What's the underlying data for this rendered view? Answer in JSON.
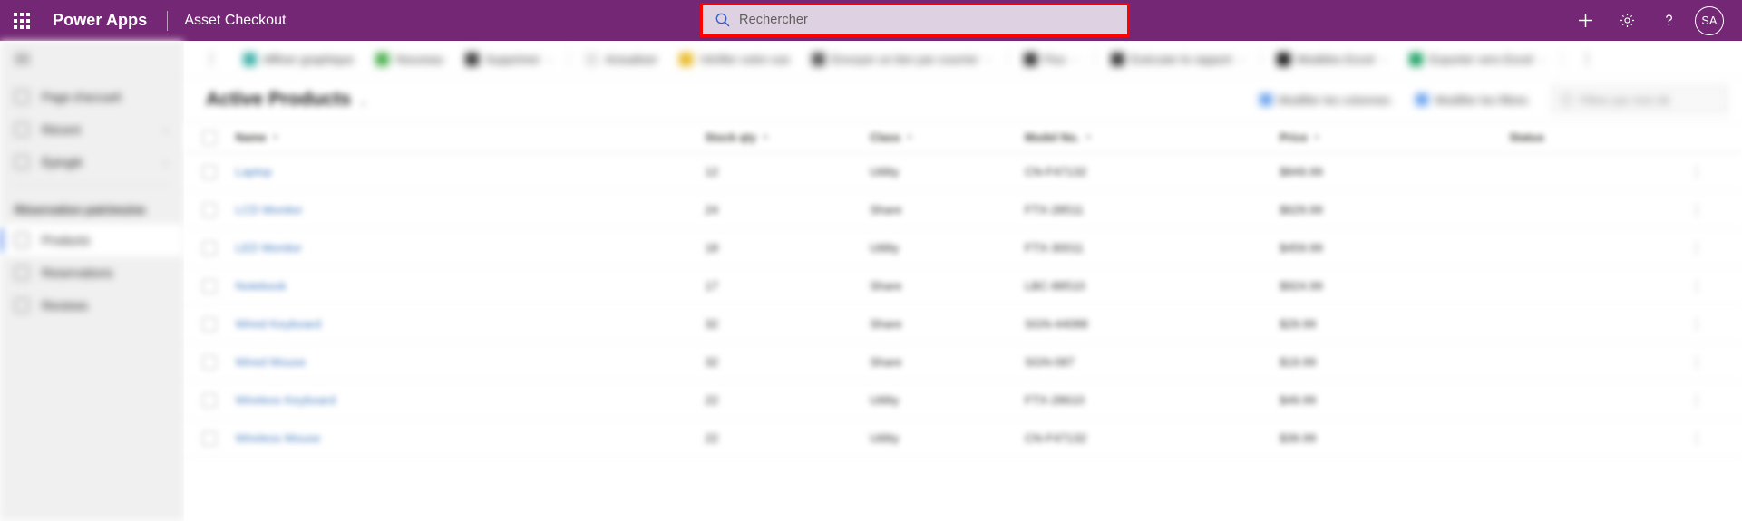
{
  "header": {
    "waffle_label": "app-launcher",
    "brand": "Power Apps",
    "app_name": "Asset Checkout",
    "search": {
      "placeholder": "Rechercher",
      "value": "",
      "highlight_color": "#ff0000",
      "box_color": "#ded2e2",
      "icon": "search-icon"
    },
    "actions": [
      {
        "name": "new-button",
        "icon": "plus-icon"
      },
      {
        "name": "settings-button",
        "icon": "gear-icon"
      },
      {
        "name": "help-button",
        "icon": "question-mark-icon"
      }
    ],
    "avatar_initials": "SA",
    "bar_color": "#742774"
  },
  "sidebar": {
    "hamburger": "site-map-toggle",
    "items": [
      {
        "label": "Page d'accueil",
        "icon": "home-icon",
        "chevron": "",
        "selected": false
      },
      {
        "label": "Récent",
        "icon": "clock-icon",
        "chevron": "⌄",
        "selected": false
      },
      {
        "label": "Épinglé",
        "icon": "pin-icon",
        "chevron": "⌄",
        "selected": false
      }
    ],
    "section_label": "Réservation patrimoine",
    "section_items": [
      {
        "label": "Products",
        "icon": "products-icon",
        "selected": true
      },
      {
        "label": "Reservations",
        "icon": "reservations-icon",
        "selected": false
      },
      {
        "label": "Reviews",
        "icon": "reviews-icon",
        "selected": false
      }
    ]
  },
  "command_bar": {
    "items": [
      {
        "label": "Affiner graphique",
        "icon_color": "#3fb0a8",
        "chevron": ""
      },
      {
        "label": "Nouveau",
        "icon_color": "#4caf50",
        "chevron": ""
      },
      {
        "label": "Supprimer",
        "icon_color": "#3b3b3b",
        "chevron": "⌄"
      },
      {
        "label": "Actualiser",
        "icon_color": "#ffffff",
        "chevron": ""
      },
      {
        "label": "Vérifier votre vue",
        "icon_color": "#e8b924",
        "chevron": ""
      },
      {
        "label": "Envoyer un lien par courrier",
        "icon_color": "#5b5b5b",
        "chevron": "⌄"
      },
      {
        "label": "Flux",
        "icon_color": "#3b3b3b",
        "chevron": "⌄"
      },
      {
        "label": "Exécuter le rapport",
        "icon_color": "#3b3b3b",
        "chevron": "⌄"
      },
      {
        "label": "Modèles Excel",
        "icon_color": "#1b1b1b",
        "chevron": "⌄"
      },
      {
        "label": "Exporter vers Excel",
        "icon_color": "#21a366",
        "chevron": "⌄"
      }
    ],
    "overflow": "⋮"
  },
  "view_header": {
    "title": "Active Products",
    "title_chevron": "⌄",
    "buttons": [
      {
        "label": "Modifier les colonnes",
        "icon": "columns-icon",
        "icon_color": "#6ba3ee"
      },
      {
        "label": "Modifier les filtres",
        "icon": "filter-icon",
        "icon_color": "#6ba3ee"
      }
    ],
    "grid_search_placeholder": "Filtrer par mot clé"
  },
  "grid": {
    "select_all": "select-all-checkbox",
    "columns": [
      {
        "key": "name",
        "label": "Name",
        "sortable": true
      },
      {
        "key": "qty",
        "label": "Stock qty",
        "sortable": true
      },
      {
        "key": "type",
        "label": "Class",
        "sortable": true
      },
      {
        "key": "sku",
        "label": "Model No.",
        "sortable": true
      },
      {
        "key": "price",
        "label": "Price",
        "sortable": true
      },
      {
        "key": "status",
        "label": "Status",
        "sortable": false
      }
    ],
    "rows": [
      {
        "name": "Laptop",
        "qty": "12",
        "type": "Utility",
        "sku": "CN-F47132",
        "price": "$849.99"
      },
      {
        "name": "LCD Monitor",
        "qty": "24",
        "type": "Share",
        "sku": "FTX-28511",
        "price": "$629.99"
      },
      {
        "name": "LED Monitor",
        "qty": "18",
        "type": "Utility",
        "sku": "FTX-30011",
        "price": "$459.99"
      },
      {
        "name": "Notebook",
        "qty": "17",
        "type": "Share",
        "sku": "LBC-88510",
        "price": "$924.99"
      },
      {
        "name": "Wired Keyboard",
        "qty": "32",
        "type": "Share",
        "sku": "SGN-44088",
        "price": "$29.99"
      },
      {
        "name": "Wired Mouse",
        "qty": "32",
        "type": "Share",
        "sku": "SGN-087",
        "price": "$19.99"
      },
      {
        "name": "Wireless Keyboard",
        "qty": "22",
        "type": "Utility",
        "sku": "FTX-28610",
        "price": "$49.99"
      },
      {
        "name": "Wireless Mouse",
        "qty": "22",
        "type": "Utility",
        "sku": "CN-F47132",
        "price": "$39.99"
      }
    ],
    "row_action_icon": "more-actions-icon"
  }
}
